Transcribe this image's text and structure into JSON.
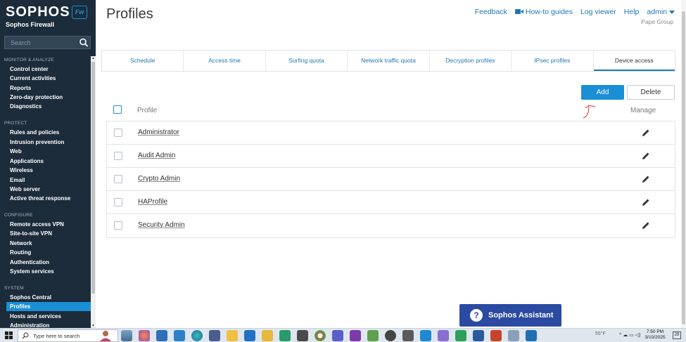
{
  "brand": {
    "name": "SOPHOS",
    "product": "Sophos Firewall",
    "logo_text": "Fw"
  },
  "search": {
    "placeholder": "Search"
  },
  "sidebar": {
    "sections": [
      {
        "label": "MONITOR & ANALYZE",
        "items": [
          "Control center",
          "Current activities",
          "Reports",
          "Zero-day protection",
          "Diagnostics"
        ]
      },
      {
        "label": "PROTECT",
        "items": [
          "Rules and policies",
          "Intrusion prevention",
          "Web",
          "Applications",
          "Wireless",
          "Email",
          "Web server",
          "Active threat response"
        ]
      },
      {
        "label": "CONFIGURE",
        "items": [
          "Remote access VPN",
          "Site-to-site VPN",
          "Network",
          "Routing",
          "Authentication",
          "System services"
        ]
      },
      {
        "label": "SYSTEM",
        "items": [
          "Sophos Central",
          "Profiles",
          "Hosts and services",
          "Administration"
        ]
      }
    ],
    "active_item": "Profiles"
  },
  "header": {
    "title": "Profiles",
    "links": {
      "feedback": "Feedback",
      "howto": "How-to guides",
      "log_viewer": "Log viewer",
      "help": "Help",
      "admin": "admin"
    },
    "org": "Pape Group"
  },
  "tabs": [
    "Schedule",
    "Access time",
    "Surfing quota",
    "Network traffic quota",
    "Decryption profiles",
    "IPsec profiles",
    "Device access"
  ],
  "active_tab": "Device access",
  "actions": {
    "add": "Add",
    "delete": "Delete"
  },
  "table": {
    "columns": {
      "profile": "Profile",
      "manage": "Manage"
    },
    "rows": [
      "Administrator",
      "Audit Admin",
      "Crypto Admin",
      "HAProfile",
      "Security Admin"
    ]
  },
  "assistant": {
    "label": "Sophos Assistant",
    "icon": "question-icon"
  },
  "taskbar": {
    "search_placeholder": "Type here to search",
    "weather": "55°F",
    "time": "7:50 PM",
    "date": "3/10/2025",
    "notifications": "29"
  },
  "colors": {
    "accent": "#1a8fd6",
    "sidebar": "#1c2c3b",
    "assistant": "#2b4aa1"
  }
}
